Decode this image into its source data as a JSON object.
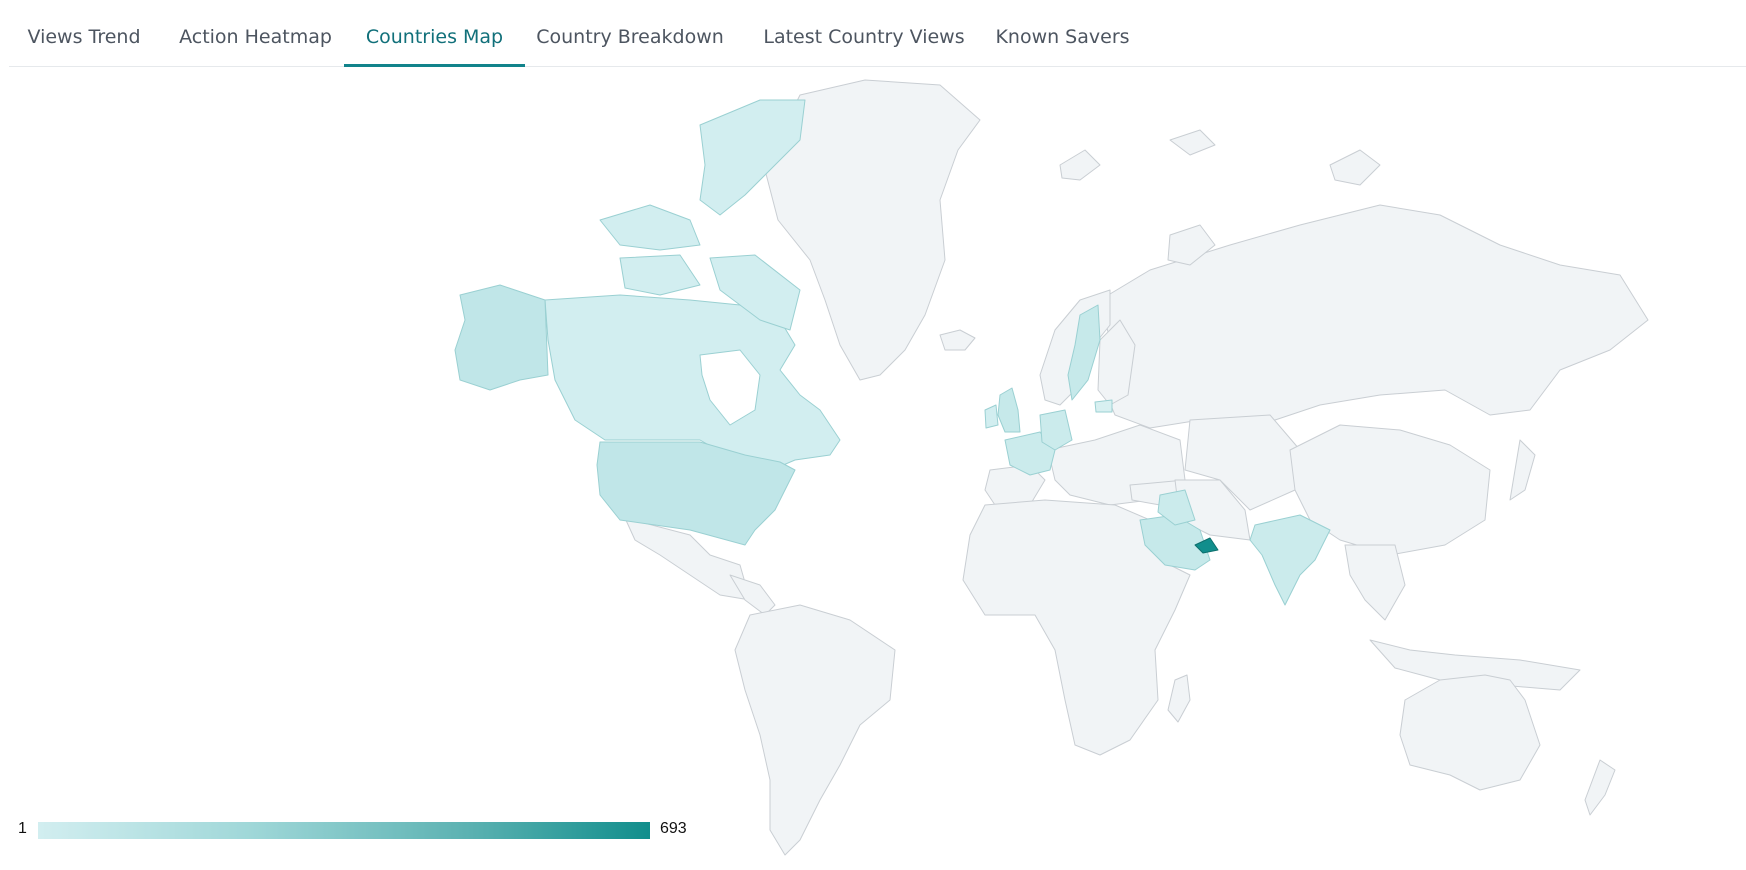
{
  "tabs": [
    {
      "label": "Views Trend",
      "active": false
    },
    {
      "label": "Action Heatmap",
      "active": false
    },
    {
      "label": "Countries Map",
      "active": true
    },
    {
      "label": "Country Breakdown",
      "active": false
    },
    {
      "label": "Latest Country Views",
      "active": false
    },
    {
      "label": "Known Savers",
      "active": false
    }
  ],
  "legend": {
    "min": "1",
    "max": "693"
  },
  "colors": {
    "accent": "#11838b",
    "scale_low": "#d2eef0",
    "scale_high": "#118e8c",
    "no_data": "#f1f4f6",
    "border": "#c9ced3"
  },
  "map": {
    "highlighted_countries": [
      {
        "name": "United Arab Emirates",
        "level": 1.0
      },
      {
        "name": "United States",
        "level": 0.08
      },
      {
        "name": "Saudi Arabia",
        "level": 0.04
      },
      {
        "name": "Canada",
        "level": 0.02
      },
      {
        "name": "India",
        "level": 0.02
      },
      {
        "name": "Sweden",
        "level": 0.03
      },
      {
        "name": "United Kingdom",
        "level": 0.03
      },
      {
        "name": "France",
        "level": 0.02
      },
      {
        "name": "Germany",
        "level": 0.02
      },
      {
        "name": "Iraq",
        "level": 0.02
      },
      {
        "name": "Latvia",
        "level": 0.01
      }
    ]
  }
}
